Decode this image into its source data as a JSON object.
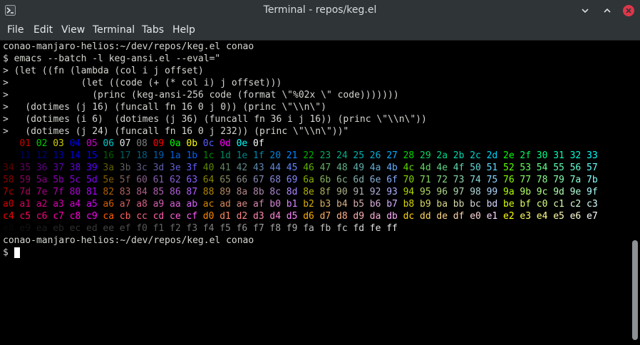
{
  "window": {
    "title": "Terminal - repos/keg.el"
  },
  "menu": [
    {
      "id": "file",
      "label": "File"
    },
    {
      "id": "edit",
      "label": "Edit"
    },
    {
      "id": "view",
      "label": "View"
    },
    {
      "id": "terminal",
      "label": "Terminal"
    },
    {
      "id": "tabs",
      "label": "Tabs"
    },
    {
      "id": "help",
      "label": "Help"
    }
  ],
  "terminal": {
    "lines": [
      "conao-manjaro-helios:~/dev/repos/keg.el conao",
      "$ emacs --batch -l keg-ansi.el --eval=\"",
      "> (let ((fn (lambda (col i j offset)",
      ">             (let ((code (+ (* col i) j offset)))",
      ">               (princ (keg-ansi-256 code (format \\\"%02x \\\" code)))))))",
      ">   (dotimes (j 16) (funcall fn 16 0 j 0)) (princ \\\"\\\\n\\\")",
      ">   (dotimes (i 6)  (dotimes (j 36) (funcall fn 36 i j 16)) (princ \\\"\\\\n\\\"))",
      ">   (dotimes (j 24) (funcall fn 16 0 j 232)) (princ \\\"\\\\n\\\"))\""
    ],
    "prompt_after": "conao-manjaro-helios:~/dev/repos/keg.el conao",
    "prompt_symbol": "$"
  },
  "colors": {
    "titlebar": "#2f3437",
    "terminal_bg": "#000000",
    "text": "#d3d7cf",
    "close_button": "#e0364a"
  }
}
